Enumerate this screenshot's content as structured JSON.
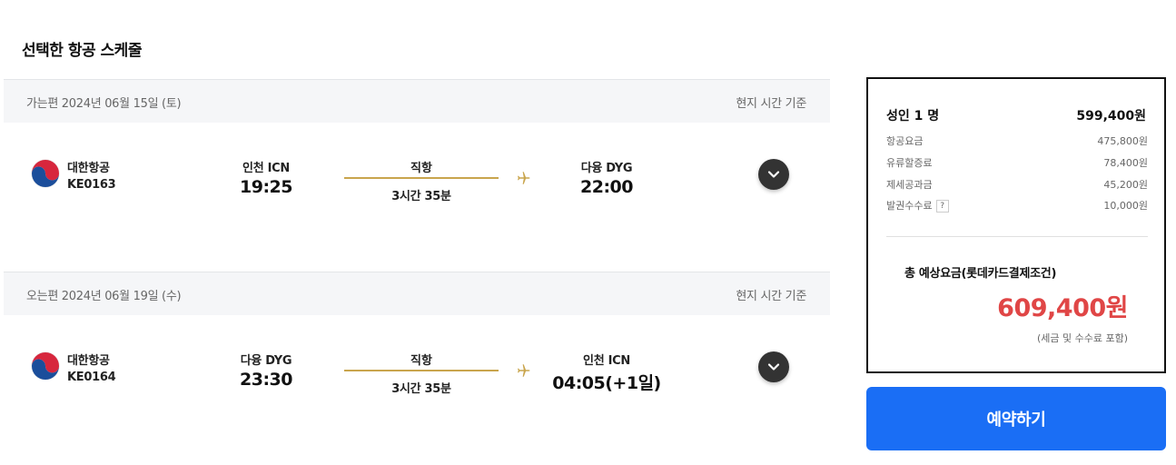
{
  "page": {
    "title": "선택한 항공 스케줄"
  },
  "segments": [
    {
      "header": {
        "date": "가는편 2024년 06월 15일 (토)",
        "tz": "현지 시간 기준"
      },
      "airline": {
        "name": "대한항공",
        "flight_no": "KE0163",
        "logo_icon": "korean-air-logo"
      },
      "departure": {
        "port": "인천 ICN",
        "time": "19:25"
      },
      "route": {
        "type": "직항",
        "duration": "3시간 35분"
      },
      "arrival": {
        "port": "다융 DYG",
        "time": "22:00"
      }
    },
    {
      "header": {
        "date": "오는편 2024년 06월 19일 (수)",
        "tz": "현지 시간 기준"
      },
      "airline": {
        "name": "대한항공",
        "flight_no": "KE0164",
        "logo_icon": "korean-air-logo"
      },
      "departure": {
        "port": "다융 DYG",
        "time": "23:30"
      },
      "route": {
        "type": "직항",
        "duration": "3시간 35분"
      },
      "arrival": {
        "port": "인천 ICN",
        "time": "04:05(+1일)"
      }
    }
  ],
  "fare": {
    "adult_label": "성인 1 명",
    "adult_amount": "599,400원",
    "items": [
      {
        "label": "항공요금",
        "amount": "475,800원"
      },
      {
        "label": "유류할증료",
        "amount": "78,400원"
      },
      {
        "label": "제세공과금",
        "amount": "45,200원"
      },
      {
        "label": "발권수수료",
        "amount": "10,000원",
        "help": "?"
      }
    ],
    "total_label": "총 예상요금(롯데카드결제조건)",
    "total_amount": "609,400원",
    "total_note": "(세금 및 수수료 포함)"
  },
  "actions": {
    "reserve_label": "예약하기"
  },
  "colors": {
    "accent": "#1a6ef5",
    "total": "#e04646",
    "route_line": "#c9a54d",
    "header_bg": "#f5f6f8"
  }
}
